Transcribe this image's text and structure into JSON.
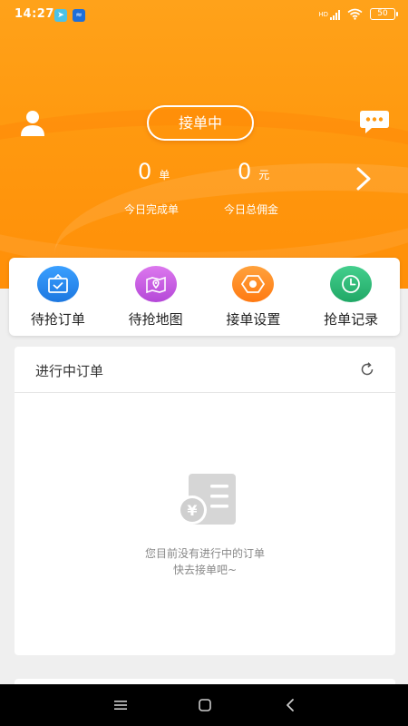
{
  "status_bar": {
    "time": "14:27",
    "battery": "50",
    "network": "HD"
  },
  "header": {
    "status_pill": "接单中",
    "today_orders": {
      "value": "0",
      "unit": "单",
      "label": "今日完成单"
    },
    "today_commission": {
      "value": "0",
      "unit": "元",
      "label": "今日总佣金"
    }
  },
  "quick_actions": [
    {
      "label": "待抢订单",
      "icon": "task-clipboard-icon",
      "color": "#2e8ef0"
    },
    {
      "label": "待抢地图",
      "icon": "map-pin-icon",
      "color": "#c45ae0"
    },
    {
      "label": "接单设置",
      "icon": "settings-hexagon-icon",
      "color": "#ff8a1f"
    },
    {
      "label": "抢单记录",
      "icon": "clock-icon",
      "color": "#2db77a"
    }
  ],
  "orders_panel": {
    "title": "进行中订单",
    "empty_line1": "您目前没有进行中的订单",
    "empty_line2": "快去接单吧~"
  },
  "colors": {
    "brand_orange": "#ff9a10",
    "background": "#efefef"
  }
}
